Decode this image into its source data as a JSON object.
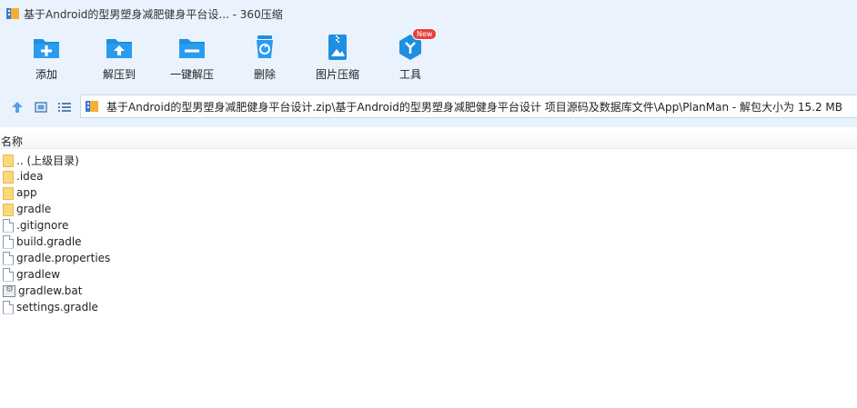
{
  "window": {
    "title": "基于Android的型男塑身减肥健身平台设... - 360压缩"
  },
  "toolbar": {
    "items": [
      {
        "label": "添加",
        "icon": "add-icon"
      },
      {
        "label": "解压到",
        "icon": "extract-to-icon"
      },
      {
        "label": "一键解压",
        "icon": "one-click-extract-icon"
      },
      {
        "label": "删除",
        "icon": "delete-icon"
      },
      {
        "label": "图片压缩",
        "icon": "image-compress-icon"
      },
      {
        "label": "工具",
        "icon": "tools-icon",
        "badge": "New"
      }
    ]
  },
  "address": {
    "path": "基于Android的型男塑身减肥健身平台设计.zip\\基于Android的型男塑身减肥健身平台设计 项目源码及数据库文件\\App\\PlanMan - 解包大小为 15.2 MB"
  },
  "list": {
    "column_name": "名称",
    "files": [
      {
        "name": ".. (上级目录)",
        "type": "folder"
      },
      {
        "name": ".idea",
        "type": "folder"
      },
      {
        "name": "app",
        "type": "folder"
      },
      {
        "name": "gradle",
        "type": "folder"
      },
      {
        "name": ".gitignore",
        "type": "file"
      },
      {
        "name": "build.gradle",
        "type": "file"
      },
      {
        "name": "gradle.properties",
        "type": "file"
      },
      {
        "name": "gradlew",
        "type": "file"
      },
      {
        "name": "gradlew.bat",
        "type": "bat"
      },
      {
        "name": "settings.gradle",
        "type": "file"
      }
    ]
  },
  "colors": {
    "accent": "#1e8fe1",
    "toolbar_bg": "#eaf3fd",
    "badge": "#e8413a",
    "folder": "#fcd977"
  }
}
